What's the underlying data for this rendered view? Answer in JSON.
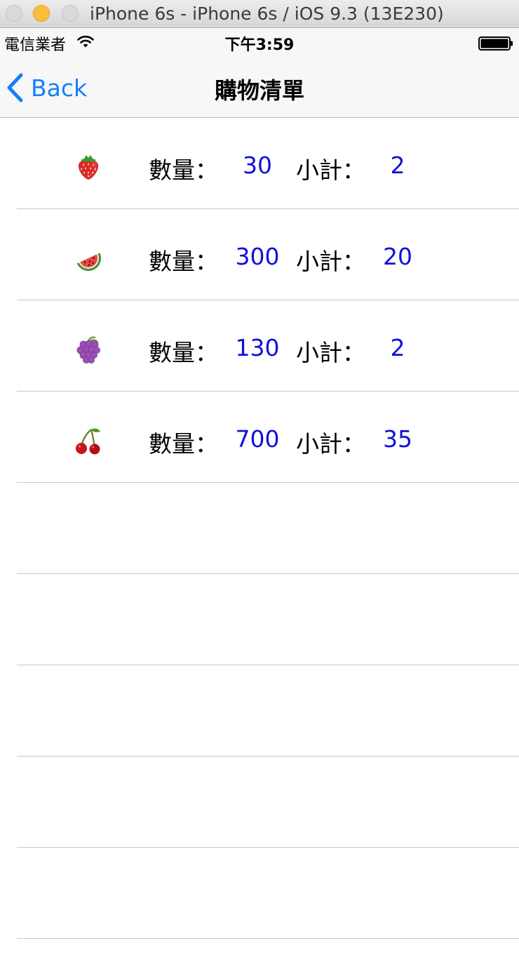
{
  "window": {
    "title": "iPhone 6s - iPhone 6s / iOS 9.3 (13E230)"
  },
  "status_bar": {
    "carrier": "電信業者",
    "time": "下午3:59"
  },
  "nav": {
    "back_label": "Back",
    "title": "購物清單"
  },
  "items": [
    {
      "fruit": "strawberry",
      "qty_label": "數量：",
      "qty": "30",
      "subtotal_label": "小計：",
      "subtotal": "2"
    },
    {
      "fruit": "watermelon",
      "qty_label": "數量：",
      "qty": "300",
      "subtotal_label": "小計：",
      "subtotal": "20"
    },
    {
      "fruit": "grapes",
      "qty_label": "數量：",
      "qty": "130",
      "subtotal_label": "小計：",
      "subtotal": "2"
    },
    {
      "fruit": "cherries",
      "qty_label": "數量：",
      "qty": "700",
      "subtotal_label": "小計：",
      "subtotal": "35"
    }
  ],
  "colors": {
    "tint": "#147efb",
    "value": "#1010dd",
    "separator": "#c8c7cc"
  }
}
